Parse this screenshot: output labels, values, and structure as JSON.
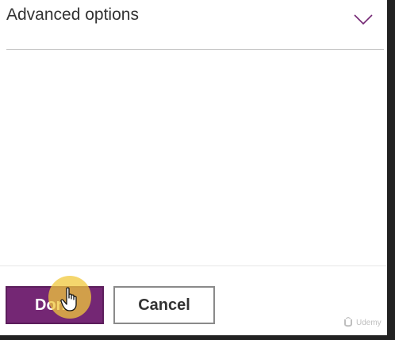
{
  "section": {
    "title": "Advanced options",
    "chevron_icon": "chevron-down-icon"
  },
  "footer": {
    "done_label": "Done",
    "cancel_label": "Cancel"
  },
  "watermark": {
    "text": "Udemy",
    "icon": "udemy-logo-icon"
  },
  "colors": {
    "accent": "#742774",
    "chevron": "#742774",
    "cursor_highlight": "#f0c83c"
  }
}
